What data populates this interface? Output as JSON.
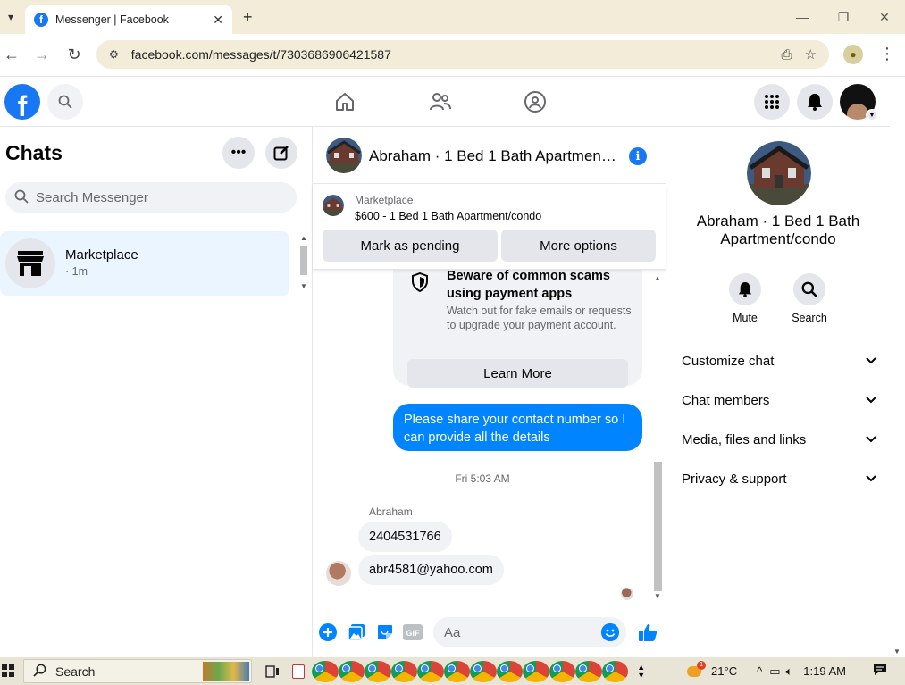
{
  "browser": {
    "tab_title": "Messenger | Facebook",
    "url": "facebook.com/messages/t/7303686906421587"
  },
  "left": {
    "title": "Chats",
    "search_placeholder": "Search Messenger",
    "chat_item": {
      "name": "Marketplace",
      "time": "· 1m"
    }
  },
  "conversation": {
    "title": "Abraham · 1 Bed 1 Bath Apartment/condo",
    "marketplace_label": "Marketplace",
    "listing": "$600 - 1 Bed 1 Bath Apartment/condo",
    "mark_pending": "Mark as pending",
    "more_options": "More options",
    "scam_heading": "Beware of common scams using payment apps",
    "scam_body": "Watch out for fake emails or requests to upgrade your payment account.",
    "learn_more": "Learn More",
    "sent_message": "Please share your contact number so I can provide all the details",
    "timestamp": "Fri 5:03 AM",
    "sender": "Abraham",
    "received": [
      "2404531766",
      "abr4581@yahoo.com"
    ],
    "composer_placeholder": "Aa"
  },
  "right": {
    "name": "Abraham · 1 Bed 1 Bath Apartment/condo",
    "mute": "Mute",
    "search": "Search",
    "rows": [
      "Customize chat",
      "Chat members",
      "Media, files and links",
      "Privacy & support"
    ]
  },
  "taskbar": {
    "search": "Search",
    "weather": "21°C",
    "time": "1:19 AM"
  },
  "colors": {
    "accent": "#1877f2",
    "bubble": "#0084ff"
  }
}
